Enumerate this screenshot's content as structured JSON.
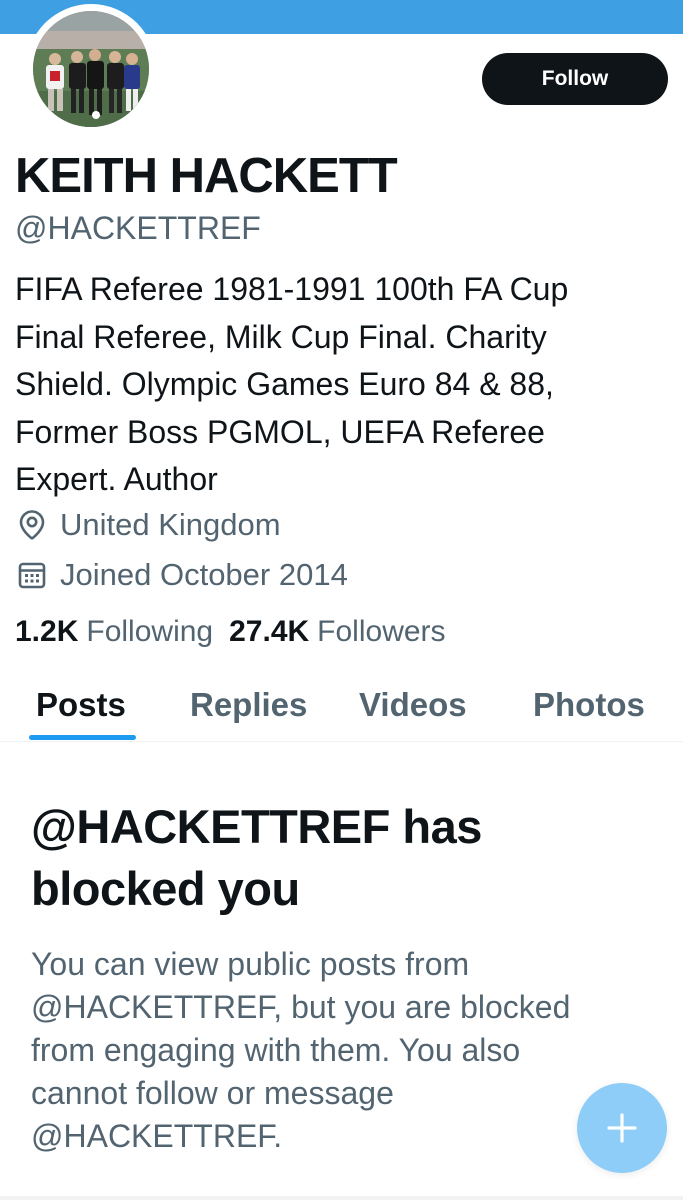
{
  "colors": {
    "banner": "#3f9fe3",
    "accent": "#1d9bf0",
    "primary_text": "#0f1419",
    "secondary_text": "#536471",
    "follow_button_bg": "#0f1419",
    "fab_bg": "#8ecdf8"
  },
  "profile": {
    "avatar_icon": "profile-photo",
    "follow_label": "Follow",
    "display_name": "KEITH HACKETT",
    "handle": "@HACKETTREF",
    "bio_lines": [
      "FIFA Referee 1981-1991 100th FA Cup",
      "Final Referee, Milk Cup Final. Charity",
      "Shield. Olympic Games Euro 84 & 88,",
      "Former Boss PGMOL, UEFA Referee",
      "Expert. Author"
    ],
    "location_icon": "location-pin-icon",
    "location": "United Kingdom",
    "joined_icon": "calendar-icon",
    "joined": "Joined October 2014",
    "following_count": "1.2K",
    "following_label": "Following",
    "followers_count": "27.4K",
    "followers_label": "Followers"
  },
  "tabs": {
    "posts": "Posts",
    "replies": "Replies",
    "videos": "Videos",
    "photos": "Photos",
    "active": "Posts"
  },
  "blocked": {
    "title_lines": [
      "@HACKETTREF has",
      "blocked you"
    ],
    "body_lines": [
      "You can view public posts from",
      "@HACKETTREF, but you are blocked",
      "from engaging with them. You also",
      "cannot follow or message",
      "@HACKETTREF."
    ]
  },
  "fab": {
    "icon": "plus-icon"
  }
}
